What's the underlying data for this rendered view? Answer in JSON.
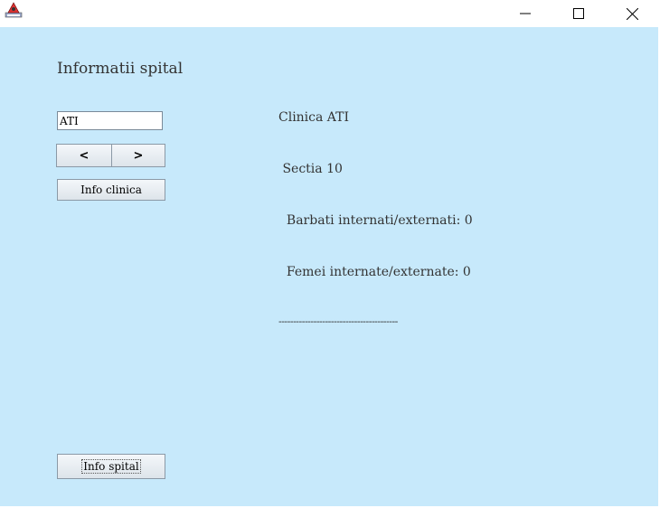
{
  "window": {
    "controls": {
      "minimize": "—",
      "maximize": "☐",
      "close": "✕"
    }
  },
  "panel": {
    "title": "Informatii spital",
    "clinic_input_value": "ATI",
    "prev_label": "<",
    "next_label": ">",
    "info_clinica_label": "Info clinica",
    "info_spital_label": "Info spital"
  },
  "output": {
    "lines": [
      "Clinica ATI",
      " Sectia 10",
      "  Barbati internati/externati: 0",
      "  Femei internate/externate: 0",
      "-----------------------------------------"
    ]
  },
  "colors": {
    "background": "#c7e9fb",
    "titlebar": "#ffffff"
  },
  "icons": {
    "app": "java-app-icon",
    "minimize": "minimize-icon",
    "maximize": "maximize-icon",
    "close": "close-icon"
  }
}
